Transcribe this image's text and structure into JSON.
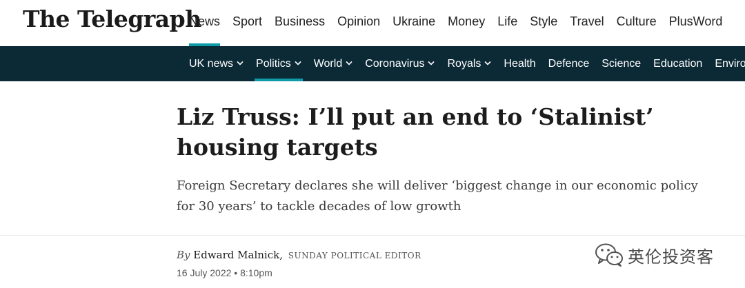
{
  "brand": {
    "logo_text": "The Telegraph"
  },
  "primary_nav": {
    "items": [
      {
        "label": "News",
        "active": true
      },
      {
        "label": "Sport",
        "active": false
      },
      {
        "label": "Business",
        "active": false
      },
      {
        "label": "Opinion",
        "active": false
      },
      {
        "label": "Ukraine",
        "active": false
      },
      {
        "label": "Money",
        "active": false
      },
      {
        "label": "Life",
        "active": false
      },
      {
        "label": "Style",
        "active": false
      },
      {
        "label": "Travel",
        "active": false
      },
      {
        "label": "Culture",
        "active": false
      },
      {
        "label": "PlusWord",
        "active": false
      }
    ]
  },
  "sub_nav": {
    "items": [
      {
        "label": "UK news",
        "dropdown": true,
        "active": false
      },
      {
        "label": "Politics",
        "dropdown": true,
        "active": true
      },
      {
        "label": "World",
        "dropdown": true,
        "active": false
      },
      {
        "label": "Coronavirus",
        "dropdown": true,
        "active": false
      },
      {
        "label": "Royals",
        "dropdown": true,
        "active": false
      },
      {
        "label": "Health",
        "dropdown": false,
        "active": false
      },
      {
        "label": "Defence",
        "dropdown": false,
        "active": false
      },
      {
        "label": "Science",
        "dropdown": false,
        "active": false
      },
      {
        "label": "Education",
        "dropdown": false,
        "active": false
      },
      {
        "label": "Environment",
        "dropdown": false,
        "active": false
      }
    ]
  },
  "article": {
    "headline": "Liz Truss: I’ll put an end to ‘Stalinist’ housing targets",
    "standfirst": "Foreign Secretary declares she will deliver ‘biggest change in our economic policy for 30 years’ to tackle decades of low growth",
    "byline_prefix": "By",
    "author": "Edward Malnick,",
    "author_role": "SUNDAY POLITICAL EDITOR",
    "date": "16 July 2022 • 8:10pm"
  },
  "watermark": {
    "text": "英伦投资客",
    "icon": "wechat-icon"
  },
  "colors": {
    "accent": "#0e9aa7",
    "subnav_bg": "#0b2a36"
  }
}
